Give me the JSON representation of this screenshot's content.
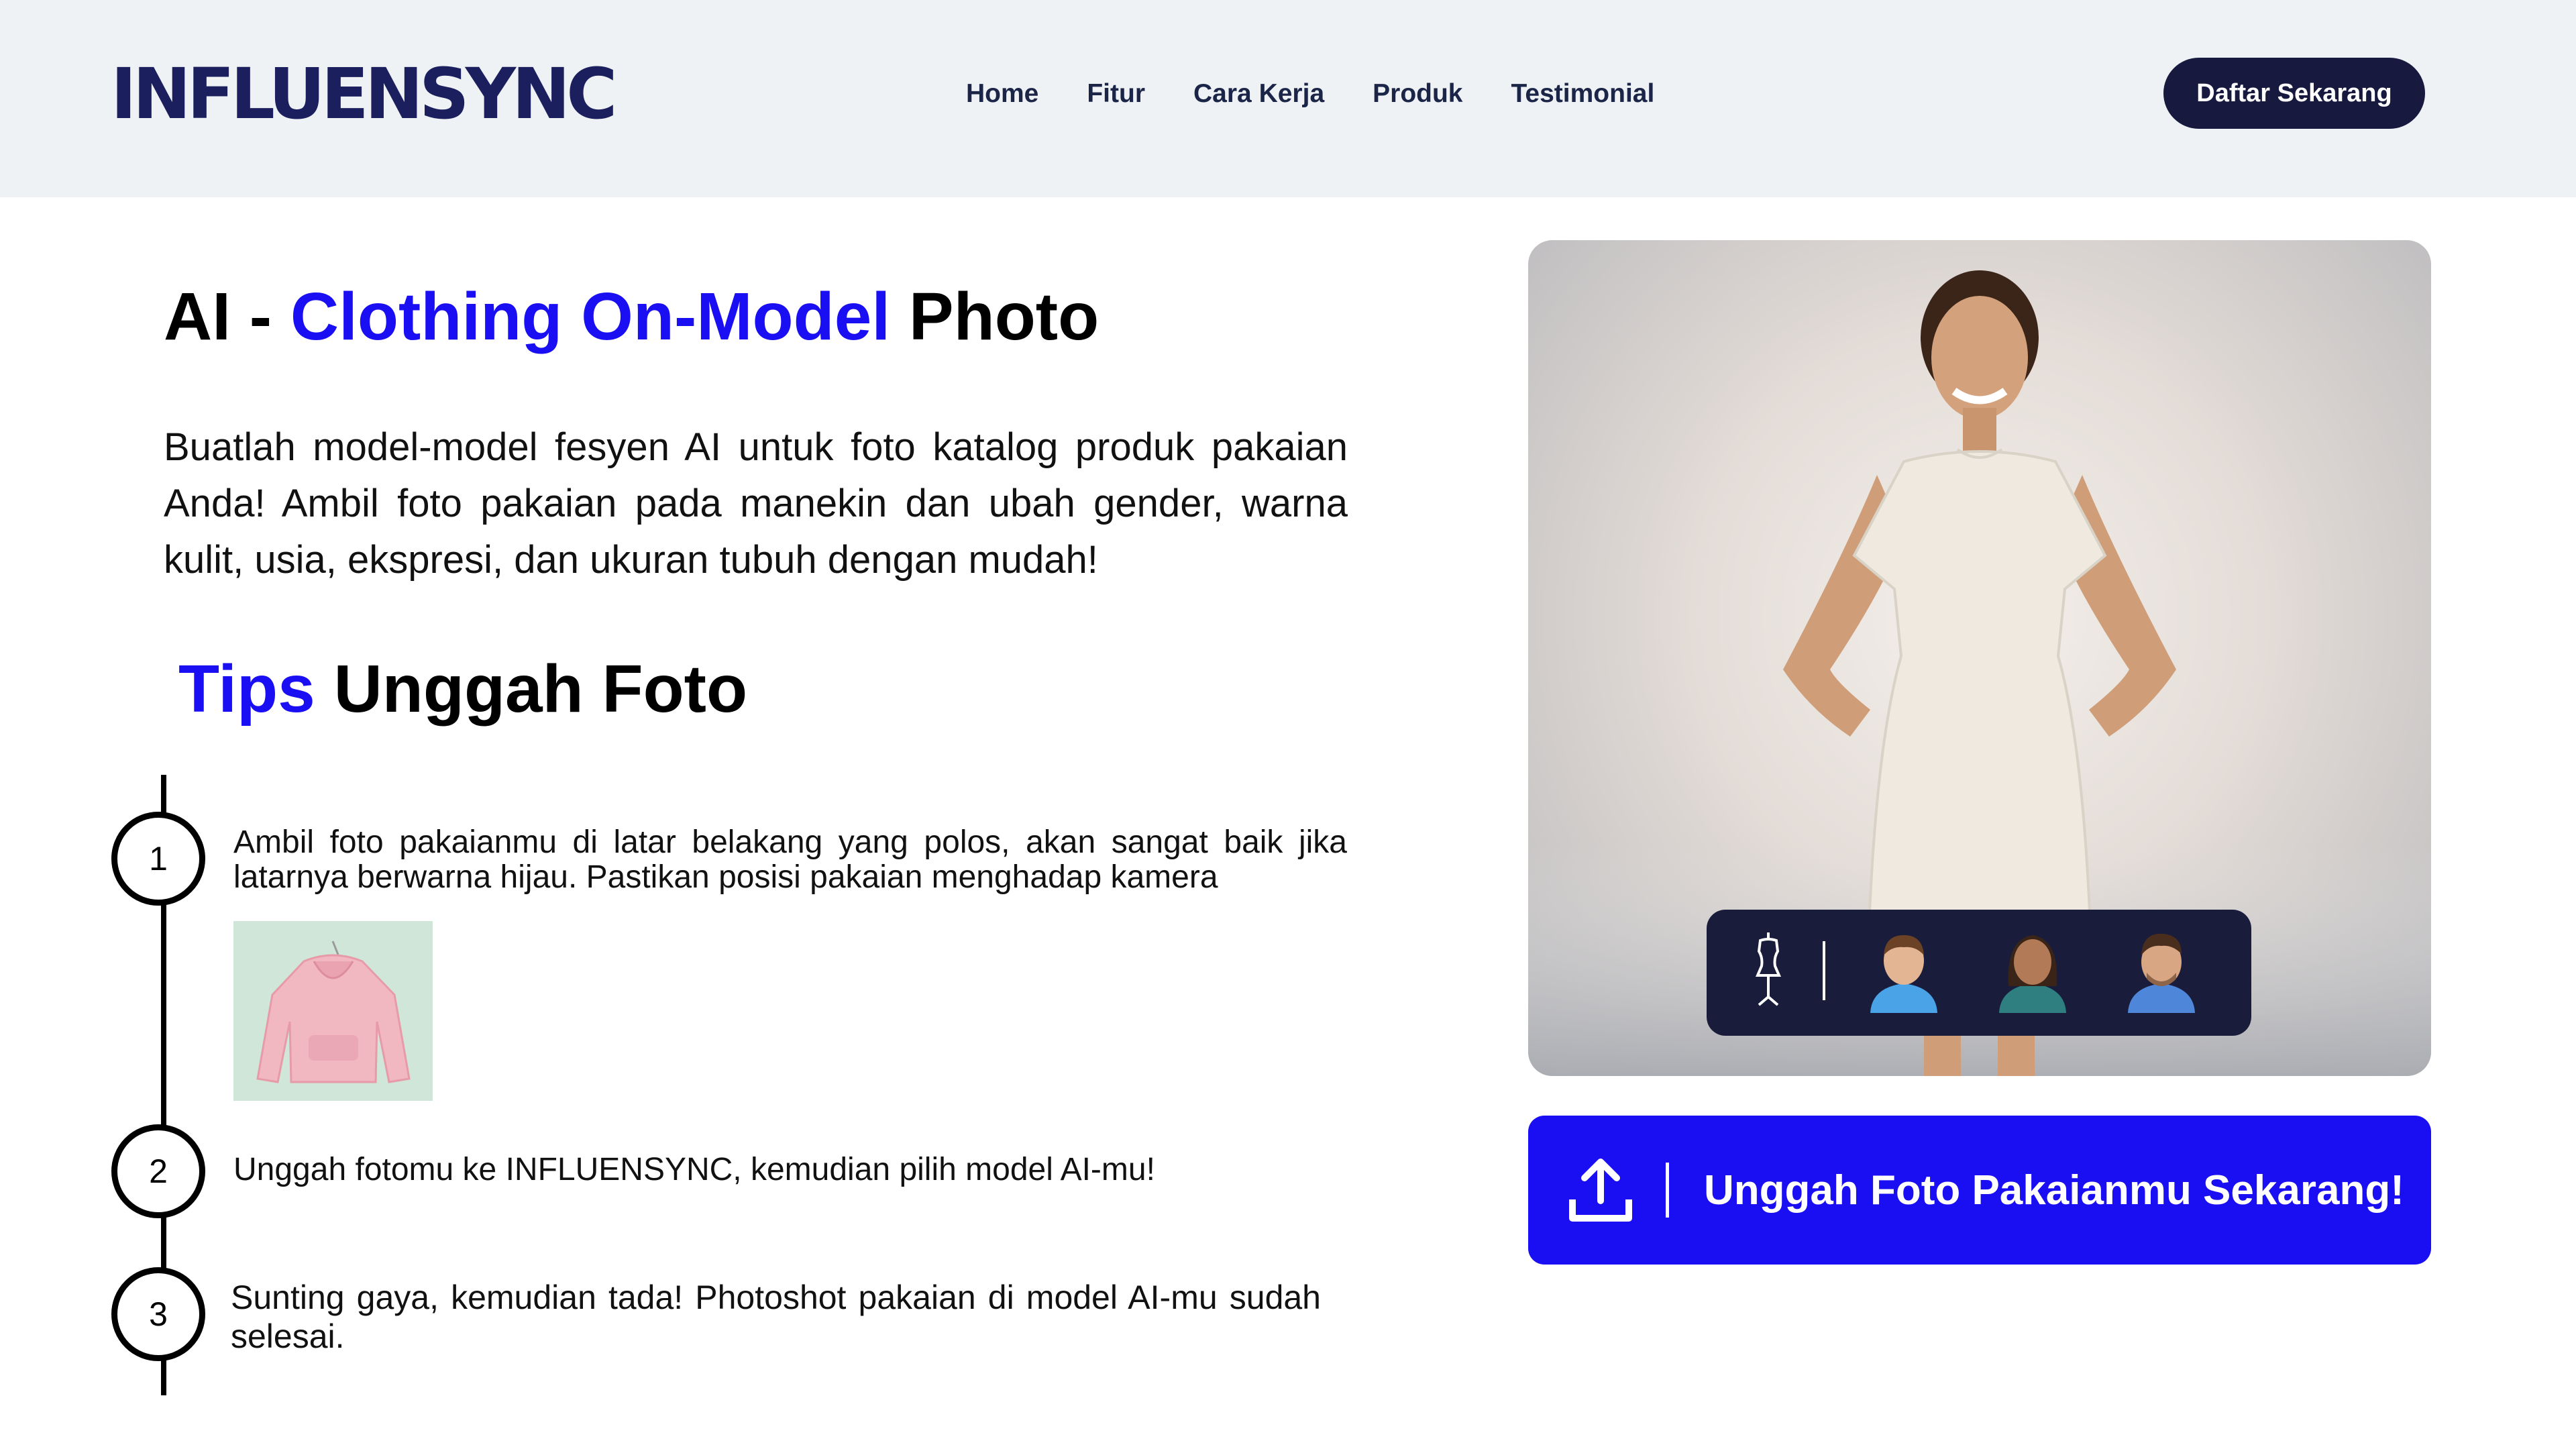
{
  "header": {
    "logo_text": "INFLUENSYNC",
    "nav": [
      "Home",
      "Fitur",
      "Cara Kerja",
      "Produk",
      "Testimonial"
    ],
    "cta_label": "Daftar Sekarang"
  },
  "hero_section": {
    "title_prefix": "AI - ",
    "title_highlight": "Clothing On-Model",
    "title_suffix": " Photo",
    "intro": "Buatlah model-model fesyen AI untuk foto katalog produk pakaian Anda! Ambil foto pakaian pada manekin dan ubah  gender, warna kulit, usia, ekspresi, dan ukuran tubuh dengan mudah!"
  },
  "tips": {
    "title_highlight": "Tips",
    "title_rest": "Unggah Foto",
    "steps": [
      {
        "number": "1",
        "text": "Ambil foto pakaianmu di latar belakang yang polos, akan sangat baik jika latarnya berwarna hijau. Pastikan posisi pakaian menghadap kamera"
      },
      {
        "number": "2",
        "text": "Unggah fotomu ke INFLUENSYNC, kemudian pilih model AI-mu!"
      },
      {
        "number": "3",
        "text": "Sunting gaya, kemudian tada! Photoshot pakaian di model AI-mu sudah selesai."
      }
    ]
  },
  "model_selector": {
    "icons": [
      "mannequin-icon",
      "boy-avatar-icon",
      "woman-avatar-icon",
      "man-avatar-icon"
    ]
  },
  "upload": {
    "label": "Unggah Foto Pakaianmu Sekarang!",
    "icon": "upload-icon"
  },
  "colors": {
    "accent_blue": "#1a0ef2",
    "navy": "#17193f",
    "header_bg": "#eff2f4"
  }
}
